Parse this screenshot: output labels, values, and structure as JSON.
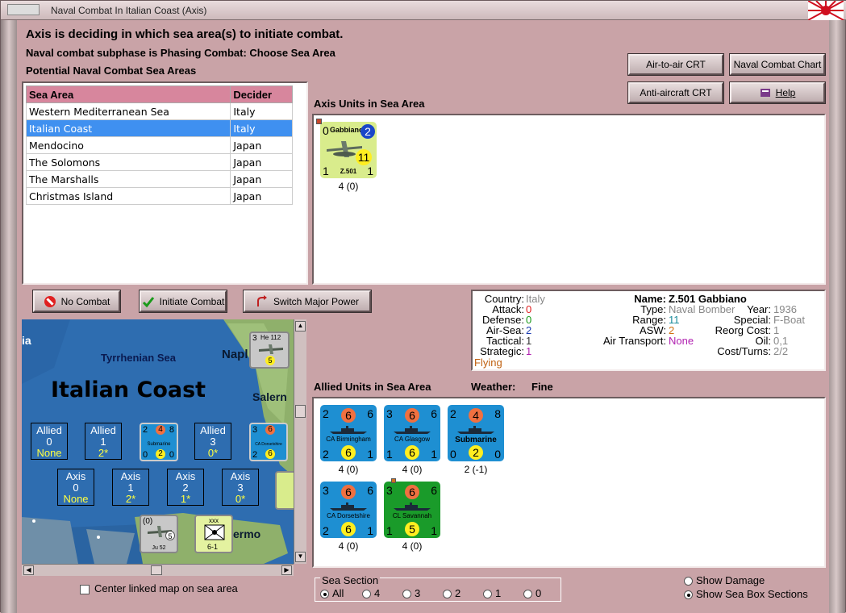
{
  "window": {
    "title": "Naval Combat In Italian Coast (Axis)"
  },
  "header": {
    "main": "Axis is deciding in which sea area(s) to initiate combat.",
    "subphase": "Naval combat subphase is Phasing Combat: Choose Sea Area",
    "potential": "Potential Naval Combat Sea Areas"
  },
  "buttons": {
    "air_to_air": "Air-to-air CRT",
    "naval_combat_chart": "Naval Combat Chart",
    "anti_aircraft": "Anti-aircraft CRT",
    "help": "Help",
    "no_combat": "No Combat",
    "initiate_combat": "Initiate Combat",
    "switch_major_power": "Switch Major Power"
  },
  "sea_table": {
    "headers": [
      "Sea Area",
      "Decider"
    ],
    "rows": [
      [
        "Western Mediterranean Sea",
        "Italy"
      ],
      [
        "Italian Coast",
        "Italy"
      ],
      [
        "Mendocino",
        "Japan"
      ],
      [
        "The Solomons",
        "Japan"
      ],
      [
        "The Marshalls",
        "Japan"
      ],
      [
        "Christmas Island",
        "Japan"
      ]
    ],
    "selected_index": 1
  },
  "axis_units": {
    "label": "Axis Units in Sea Area",
    "units": [
      {
        "name": "Z.501",
        "title": "Gabbiano",
        "tl": "0",
        "badge": "2",
        "big": "11",
        "bl": "1",
        "br": "1",
        "below": "4 (0)"
      }
    ]
  },
  "unit_info": {
    "country_label": "Country:",
    "country": "Italy",
    "attack_label": "Attack:",
    "attack": "0",
    "defense_label": "Defense:",
    "defense": "0",
    "airsea_label": "Air-Sea:",
    "airsea": "2",
    "tactical_label": "Tactical:",
    "tactical": "1",
    "strategic_label": "Strategic:",
    "strategic": "1",
    "status": "Flying",
    "name_label": "Name:",
    "name": "Z.501 Gabbiano",
    "type_label": "Type:",
    "type": "Naval Bomber",
    "year_label": "Year:",
    "year": "1936",
    "range_label": "Range:",
    "range": "11",
    "special_label": "Special:",
    "special": "F-Boat",
    "asw_label": "ASW:",
    "asw": "2",
    "reorg_label": "Reorg Cost:",
    "reorg": "1",
    "airtrans_label": "Air Transport:",
    "airtrans": "None",
    "oil_label": "Oil:",
    "oil": "0,1",
    "cost_label": "Cost/Turns:",
    "cost": "2/2"
  },
  "allied_units": {
    "label": "Allied Units in Sea Area",
    "weather_label": "Weather:",
    "weather": "Fine",
    "units": [
      {
        "name": "CA Birmingham",
        "tl": "2",
        "tc": "6",
        "tr": "6",
        "bl": "2",
        "bc": "6",
        "br": "1",
        "below": "4 (0)",
        "color": "#1e8fd2"
      },
      {
        "name": "CA Glasgow",
        "tl": "3",
        "tc": "6",
        "tr": "6",
        "bl": "1",
        "bc": "6",
        "br": "1",
        "below": "4 (0)",
        "color": "#1e8fd2"
      },
      {
        "name": "Submarine",
        "tl": "2",
        "tc": "4",
        "tr": "8",
        "bl": "0",
        "bc": "2",
        "br": "0",
        "below": "2 (-1)",
        "color": "#1e8fd2"
      },
      {
        "name": "CA Dorsetshire",
        "tl": "3",
        "tc": "6",
        "tr": "6",
        "bl": "2",
        "bc": "6",
        "br": "1",
        "below": "4 (0)",
        "color": "#1e8fd2"
      },
      {
        "name": "CL Savannah",
        "tl": "3",
        "tc": "6",
        "tr": "6",
        "bl": "1",
        "bc": "5",
        "br": "1",
        "below": "4 (0)",
        "color": "#1a9b2a"
      }
    ]
  },
  "map": {
    "title": "Italian Coast",
    "sea_label": "Tyrrhenian Sea",
    "city1": "Napl",
    "city2": "Salern",
    "city3": "ermo",
    "edge": "ia",
    "allied_label": "Allied",
    "axis_label": "Axis",
    "allied_boxes": [
      {
        "num": "0",
        "sub": "None"
      },
      {
        "num": "1",
        "sub": "2*"
      },
      {
        "num": "3",
        "sub": "0*"
      }
    ],
    "axis_boxes": [
      {
        "num": "0",
        "sub": "None"
      },
      {
        "num": "1",
        "sub": "2*"
      },
      {
        "num": "2",
        "sub": "1*"
      },
      {
        "num": "3",
        "sub": "0*"
      }
    ],
    "he112": "He 112",
    "ju52": "Ju 52",
    "center_link": "Center linked map on sea area"
  },
  "sea_section": {
    "label": "Sea Section",
    "options": [
      "All",
      "4",
      "3",
      "2",
      "1",
      "0"
    ],
    "selected": "All"
  },
  "view_options": {
    "show_damage": "Show Damage",
    "show_sea_box": "Show Sea Box Sections"
  },
  "colors": {
    "background": "#c9a3a7",
    "selected_row": "#3f90f0",
    "table_header": "#d7869d",
    "allied_unit": "#1e8fd2",
    "axis_unit": "#d9ec8c"
  }
}
